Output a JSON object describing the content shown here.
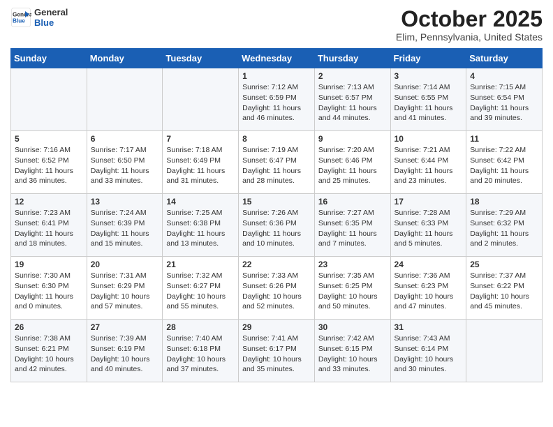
{
  "header": {
    "logo_line1": "General",
    "logo_line2": "Blue",
    "month": "October 2025",
    "location": "Elim, Pennsylvania, United States"
  },
  "days_of_week": [
    "Sunday",
    "Monday",
    "Tuesday",
    "Wednesday",
    "Thursday",
    "Friday",
    "Saturday"
  ],
  "weeks": [
    [
      {
        "day": "",
        "info": ""
      },
      {
        "day": "",
        "info": ""
      },
      {
        "day": "",
        "info": ""
      },
      {
        "day": "1",
        "info": "Sunrise: 7:12 AM\nSunset: 6:59 PM\nDaylight: 11 hours and 46 minutes."
      },
      {
        "day": "2",
        "info": "Sunrise: 7:13 AM\nSunset: 6:57 PM\nDaylight: 11 hours and 44 minutes."
      },
      {
        "day": "3",
        "info": "Sunrise: 7:14 AM\nSunset: 6:55 PM\nDaylight: 11 hours and 41 minutes."
      },
      {
        "day": "4",
        "info": "Sunrise: 7:15 AM\nSunset: 6:54 PM\nDaylight: 11 hours and 39 minutes."
      }
    ],
    [
      {
        "day": "5",
        "info": "Sunrise: 7:16 AM\nSunset: 6:52 PM\nDaylight: 11 hours and 36 minutes."
      },
      {
        "day": "6",
        "info": "Sunrise: 7:17 AM\nSunset: 6:50 PM\nDaylight: 11 hours and 33 minutes."
      },
      {
        "day": "7",
        "info": "Sunrise: 7:18 AM\nSunset: 6:49 PM\nDaylight: 11 hours and 31 minutes."
      },
      {
        "day": "8",
        "info": "Sunrise: 7:19 AM\nSunset: 6:47 PM\nDaylight: 11 hours and 28 minutes."
      },
      {
        "day": "9",
        "info": "Sunrise: 7:20 AM\nSunset: 6:46 PM\nDaylight: 11 hours and 25 minutes."
      },
      {
        "day": "10",
        "info": "Sunrise: 7:21 AM\nSunset: 6:44 PM\nDaylight: 11 hours and 23 minutes."
      },
      {
        "day": "11",
        "info": "Sunrise: 7:22 AM\nSunset: 6:42 PM\nDaylight: 11 hours and 20 minutes."
      }
    ],
    [
      {
        "day": "12",
        "info": "Sunrise: 7:23 AM\nSunset: 6:41 PM\nDaylight: 11 hours and 18 minutes."
      },
      {
        "day": "13",
        "info": "Sunrise: 7:24 AM\nSunset: 6:39 PM\nDaylight: 11 hours and 15 minutes."
      },
      {
        "day": "14",
        "info": "Sunrise: 7:25 AM\nSunset: 6:38 PM\nDaylight: 11 hours and 13 minutes."
      },
      {
        "day": "15",
        "info": "Sunrise: 7:26 AM\nSunset: 6:36 PM\nDaylight: 11 hours and 10 minutes."
      },
      {
        "day": "16",
        "info": "Sunrise: 7:27 AM\nSunset: 6:35 PM\nDaylight: 11 hours and 7 minutes."
      },
      {
        "day": "17",
        "info": "Sunrise: 7:28 AM\nSunset: 6:33 PM\nDaylight: 11 hours and 5 minutes."
      },
      {
        "day": "18",
        "info": "Sunrise: 7:29 AM\nSunset: 6:32 PM\nDaylight: 11 hours and 2 minutes."
      }
    ],
    [
      {
        "day": "19",
        "info": "Sunrise: 7:30 AM\nSunset: 6:30 PM\nDaylight: 11 hours and 0 minutes."
      },
      {
        "day": "20",
        "info": "Sunrise: 7:31 AM\nSunset: 6:29 PM\nDaylight: 10 hours and 57 minutes."
      },
      {
        "day": "21",
        "info": "Sunrise: 7:32 AM\nSunset: 6:27 PM\nDaylight: 10 hours and 55 minutes."
      },
      {
        "day": "22",
        "info": "Sunrise: 7:33 AM\nSunset: 6:26 PM\nDaylight: 10 hours and 52 minutes."
      },
      {
        "day": "23",
        "info": "Sunrise: 7:35 AM\nSunset: 6:25 PM\nDaylight: 10 hours and 50 minutes."
      },
      {
        "day": "24",
        "info": "Sunrise: 7:36 AM\nSunset: 6:23 PM\nDaylight: 10 hours and 47 minutes."
      },
      {
        "day": "25",
        "info": "Sunrise: 7:37 AM\nSunset: 6:22 PM\nDaylight: 10 hours and 45 minutes."
      }
    ],
    [
      {
        "day": "26",
        "info": "Sunrise: 7:38 AM\nSunset: 6:21 PM\nDaylight: 10 hours and 42 minutes."
      },
      {
        "day": "27",
        "info": "Sunrise: 7:39 AM\nSunset: 6:19 PM\nDaylight: 10 hours and 40 minutes."
      },
      {
        "day": "28",
        "info": "Sunrise: 7:40 AM\nSunset: 6:18 PM\nDaylight: 10 hours and 37 minutes."
      },
      {
        "day": "29",
        "info": "Sunrise: 7:41 AM\nSunset: 6:17 PM\nDaylight: 10 hours and 35 minutes."
      },
      {
        "day": "30",
        "info": "Sunrise: 7:42 AM\nSunset: 6:15 PM\nDaylight: 10 hours and 33 minutes."
      },
      {
        "day": "31",
        "info": "Sunrise: 7:43 AM\nSunset: 6:14 PM\nDaylight: 10 hours and 30 minutes."
      },
      {
        "day": "",
        "info": ""
      }
    ]
  ]
}
